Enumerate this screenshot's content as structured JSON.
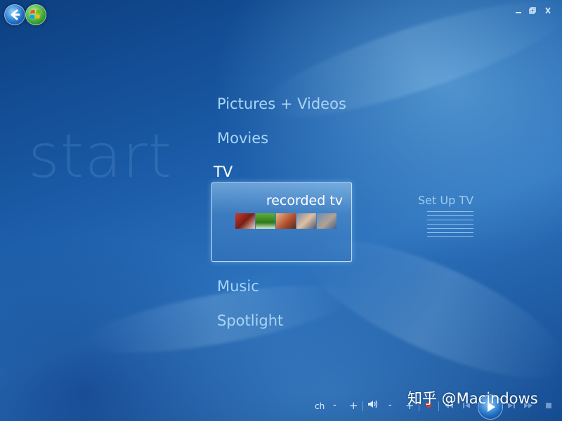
{
  "background_word": "start",
  "menu": {
    "items": [
      {
        "label": "Pictures + Videos"
      },
      {
        "label": "Movies"
      },
      {
        "label": "TV"
      },
      {
        "label": "Music"
      },
      {
        "label": "Spotlight"
      }
    ],
    "selected": {
      "tile_label": "recorded tv"
    },
    "side_option": "Set Up TV"
  },
  "transport": {
    "channel_label": "ch",
    "minus": "-",
    "plus": "+",
    "volume_minus": "-",
    "volume_plus": "+"
  },
  "watermark": "知乎 @Macindows",
  "icons": {
    "back": "back-arrow-icon",
    "logo": "windows-media-center-logo-icon",
    "minimize": "minimize-icon",
    "restore": "restore-icon",
    "close": "close-icon",
    "volume": "volume-icon",
    "record": "record-icon",
    "rewind": "rewind-icon",
    "previous": "previous-icon",
    "play": "play-icon",
    "next": "next-icon",
    "fast_forward": "fast-forward-icon",
    "stop": "stop-icon"
  },
  "colors": {
    "background": "#1a5aa6",
    "menu_text": "#a9d4f5",
    "selected_text": "#ffffff",
    "tile_border": "#d2ebff"
  }
}
